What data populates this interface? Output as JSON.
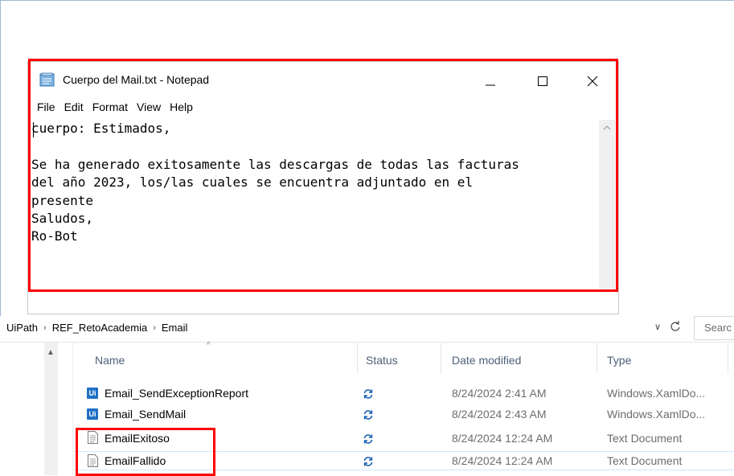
{
  "notepad": {
    "title": "Cuerpo del Mail.txt - Notepad",
    "menu": [
      "File",
      "Edit",
      "Format",
      "View",
      "Help"
    ],
    "content": "cuerpo: Estimados,\n\nSe ha generado exitosamente las descargas de todas las facturas\ndel año 2023, los/las cuales se encuentra adjuntado en el\npresente\nSaludos,\nRo-Bot"
  },
  "explorer": {
    "breadcrumbs": [
      "UiPath",
      "REF_RetoAcademia",
      "Email"
    ],
    "search_placeholder": "Searc",
    "columns": {
      "name": "Name",
      "status": "Status",
      "date": "Date modified",
      "type": "Type"
    },
    "files": [
      {
        "name": "Email_SendExceptionReport",
        "icon": "uipath-file-icon",
        "date": "8/24/2024 2:41 AM",
        "type": "Windows.XamlDo..."
      },
      {
        "name": "Email_SendMail",
        "icon": "uipath-file-icon",
        "date": "8/24/2024 2:43 AM",
        "type": "Windows.XamlDo..."
      },
      {
        "name": "EmailExitoso",
        "icon": "text-document-icon",
        "date": "8/24/2024 12:24 AM",
        "type": "Text Document"
      },
      {
        "name": "EmailFallido",
        "icon": "text-document-icon",
        "date": "8/24/2024 12:24 AM",
        "type": "Text Document"
      }
    ],
    "ui_badge": "Ui"
  },
  "colors": {
    "highlight": "#ff0000",
    "header_text": "#4c607a",
    "uipath_blue": "#1f6fc5",
    "sync_blue": "#1a5fb4"
  }
}
